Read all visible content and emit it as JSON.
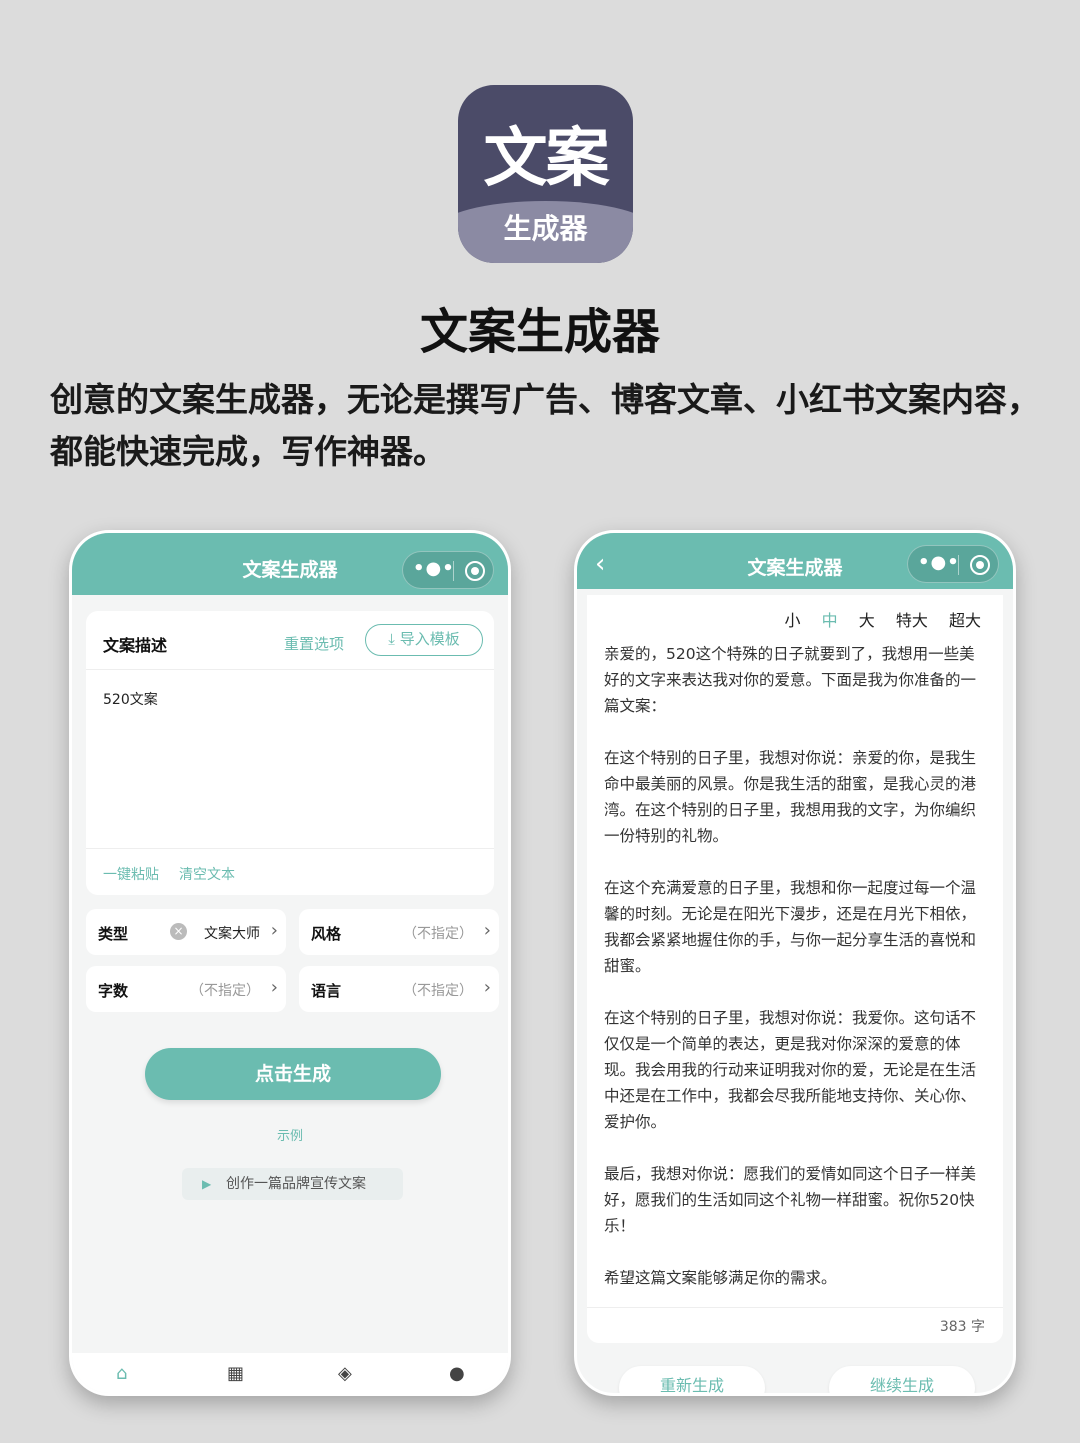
{
  "header": {
    "icon_big_text": "文案",
    "icon_small_text": "生成器",
    "title": "文案生成器",
    "description": "创意的文案生成器，无论是撰写广告、博客文章、小红书文案内容，都能快速完成，写作神器。"
  },
  "left_phone": {
    "nav_title": "文案生成器",
    "menu_dots": "•●•",
    "desc_label": "文案描述",
    "reset_label": "重置选项",
    "import_label": "⤓ 导入模板",
    "desc_content": "520文案",
    "paste_label": "一键粘贴",
    "clear_label": "清空文本",
    "options": [
      {
        "key": "类型",
        "value": "文案大师"
      },
      {
        "key": "风格",
        "value": "（不指定）"
      },
      {
        "key": "字数",
        "value": "（不指定）"
      },
      {
        "key": "语言",
        "value": "（不指定）"
      }
    ],
    "generate_label": "点击生成",
    "example_label": "示例",
    "example_chip": "创作一篇品牌宣传文案"
  },
  "right_phone": {
    "nav_title": "文案生成器",
    "menu_dots": "•●•",
    "sizes": [
      "小",
      "中",
      "大",
      "特大",
      "超大"
    ],
    "paragraphs": [
      "亲爱的，520这个特殊的日子就要到了，我想用一些美好的文字来表达我对你的爱意。下面是我为你准备的一篇文案：",
      "在这个特别的日子里，我想对你说：亲爱的你，是我生命中最美丽的风景。你是我生活的甜蜜，是我心灵的港湾。在这个特别的日子里，我想用我的文字，为你编织一份特别的礼物。",
      "在这个充满爱意的日子里，我想和你一起度过每一个温馨的时刻。无论是在阳光下漫步，还是在月光下相依，我都会紧紧地握住你的手，与你一起分享生活的喜悦和甜蜜。",
      "在这个特别的日子里，我想对你说：我爱你。这句话不仅仅是一个简单的表达，更是我对你深深的爱意的体现。我会用我的行动来证明我对你的爱，无论是在生活中还是在工作中，我都会尽我所能地支持你、关心你、爱护你。",
      "最后，我想对你说：愿我们的爱情如同这个日子一样美好，愿我们的生活如同这个礼物一样甜蜜。祝你520快乐！",
      "希望这篇文案能够满足你的需求。"
    ],
    "word_count": "383 字",
    "regenerate_label": "重新生成",
    "continue_label": "继续生成"
  }
}
